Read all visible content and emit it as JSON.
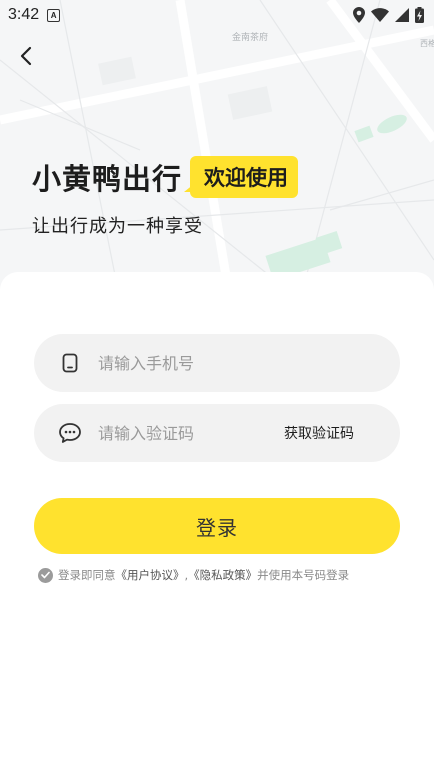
{
  "status_bar": {
    "time": "3:42",
    "notification_badge": "A",
    "icons": [
      "location-icon",
      "wifi-icon",
      "signal-icon",
      "battery-icon"
    ]
  },
  "map": {
    "labels": [
      "金南茶府",
      "西格"
    ]
  },
  "hero": {
    "title": "小黄鸭出行",
    "badge": "欢迎使用",
    "subtitle": "让出行成为一种享受"
  },
  "form": {
    "phone_placeholder": "请输入手机号",
    "code_placeholder": "请输入验证码",
    "get_code_label": "获取验证码",
    "login_label": "登录"
  },
  "agreement": {
    "prefix": "登录即同意",
    "user_agreement": "《用户协议》",
    "separator": ",",
    "privacy_policy": "《隐私政策》",
    "suffix": "并使用本号码登录",
    "checked": true
  },
  "colors": {
    "accent": "#ffe22e",
    "field_bg": "#f2f2f2",
    "text_dark": "#1d1d1d",
    "text_muted": "#8a8a8a"
  }
}
